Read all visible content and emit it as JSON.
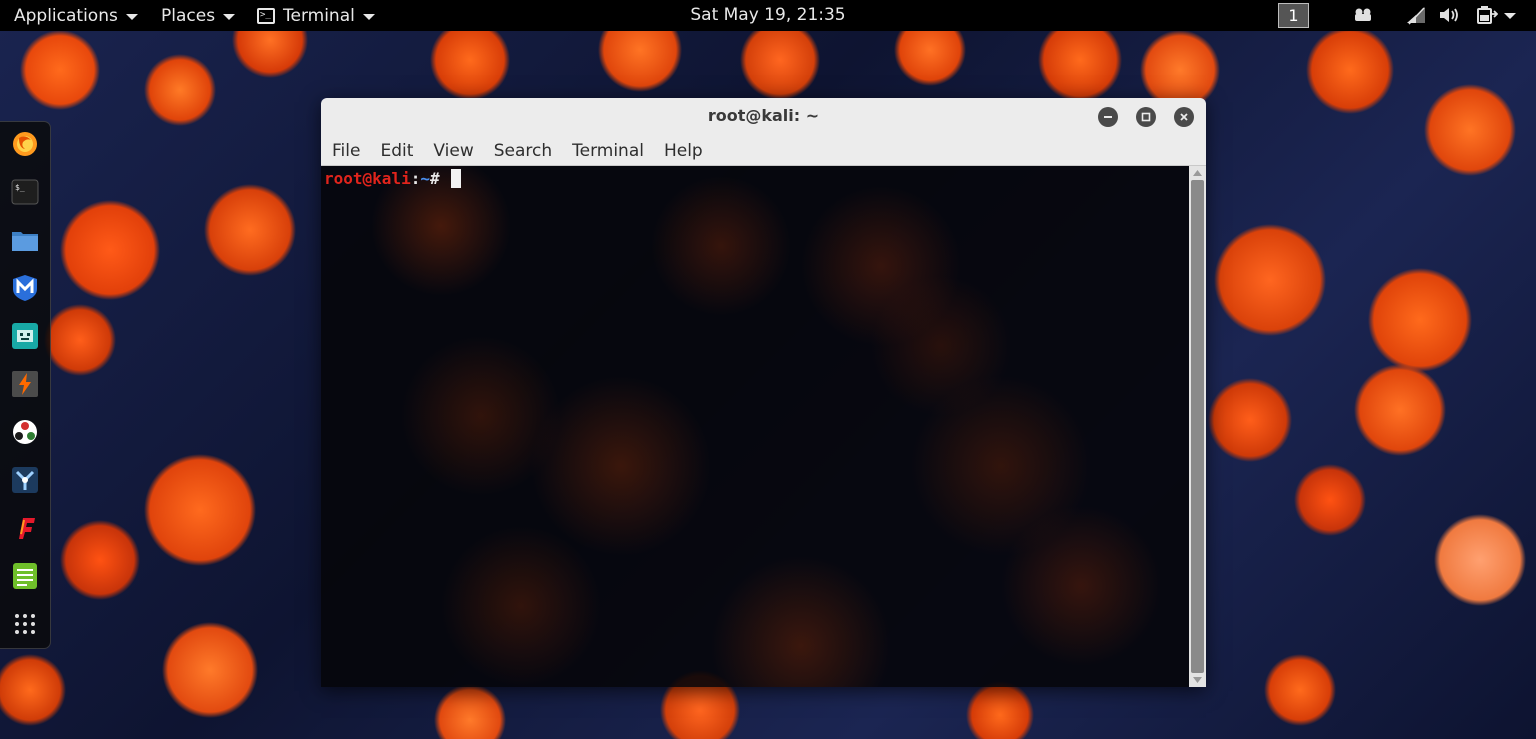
{
  "topbar": {
    "applications_label": "Applications",
    "places_label": "Places",
    "active_app_label": "Terminal",
    "clock": "Sat May 19, 21:35",
    "workspace_number": "1",
    "tray_icons": [
      "workspace-switcher-icon",
      "network-icon",
      "volume-icon",
      "power-icon"
    ]
  },
  "dock": {
    "items": [
      "firefox-icon",
      "terminal-icon",
      "files-icon",
      "metasploit-icon",
      "armitage-icon",
      "burpsuite-icon",
      "maltego-icon",
      "beef-icon",
      "faraday-icon",
      "text-editor-icon",
      "show-applications-icon"
    ]
  },
  "window": {
    "title": "root@kali: ~",
    "menu": [
      "File",
      "Edit",
      "View",
      "Search",
      "Terminal",
      "Help"
    ],
    "prompt": {
      "userhost": "root@kali",
      "colon": ":",
      "path": "~",
      "symbol": "# "
    }
  },
  "colors": {
    "prompt_red": "#e0241c",
    "prompt_blue": "#4a8ff0",
    "topbar_bg": "#000000",
    "titlebar_bg": "#ececec"
  }
}
